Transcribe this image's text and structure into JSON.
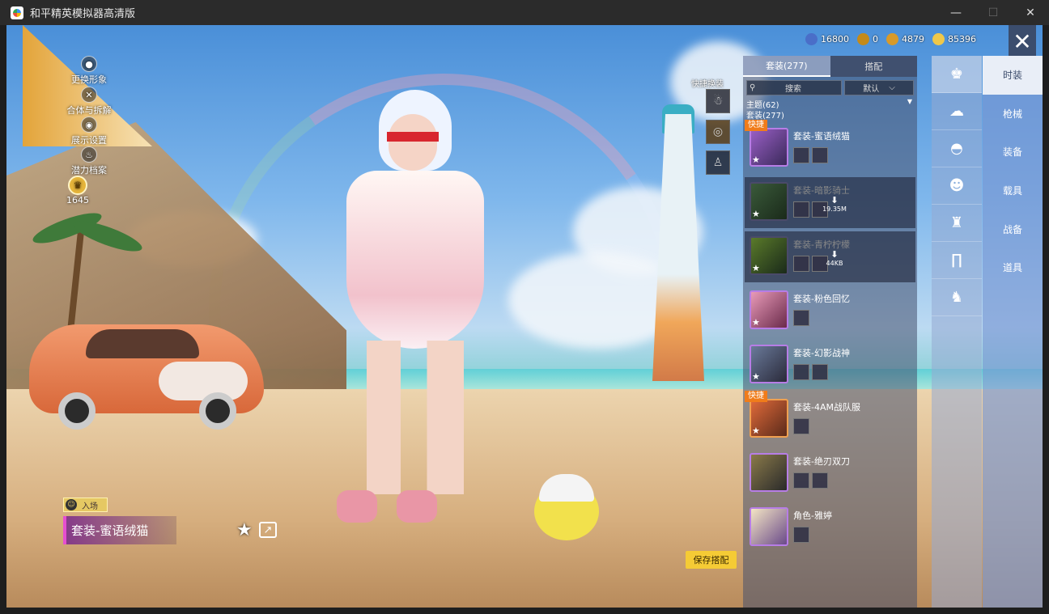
{
  "window": {
    "title": "和平精英模拟器高清版",
    "minimize": "—",
    "maximize": "☐",
    "close": "✕"
  },
  "left_menu": [
    {
      "label": "更换形象",
      "icon": "person-icon"
    },
    {
      "label": "合体与拆解",
      "icon": "split-icon"
    },
    {
      "label": "展示设置",
      "icon": "eye-icon"
    },
    {
      "label": "潜力档案",
      "icon": "flame-icon"
    }
  ],
  "level": {
    "value": "1645"
  },
  "enter_badge": {
    "label": "入场"
  },
  "current_outfit": {
    "name": "套装-蜜语绒猫"
  },
  "quick_change": {
    "label": "快捷换装"
  },
  "save_button": {
    "label": "保存搭配"
  },
  "currency": [
    {
      "value": "16800",
      "color": "#4a6ec8"
    },
    {
      "value": "0",
      "color": "#c48a1a"
    },
    {
      "value": "4879",
      "color": "#d89a2a"
    },
    {
      "value": "85396",
      "color": "#f0c84a"
    }
  ],
  "panel": {
    "tabs": [
      {
        "label": "套装(277)",
        "active": true
      },
      {
        "label": "搭配",
        "active": false
      }
    ],
    "search_placeholder": "搜索",
    "sort_label": "默认",
    "theme_line": "主题(62)",
    "suit_line": "套装(277)",
    "fast_tag": "快捷",
    "items": [
      {
        "name": "套装-蜜语绒猫",
        "fast": true,
        "downloaded": true,
        "chips": 2
      },
      {
        "name": "套装-暗影骑士",
        "fast": false,
        "downloaded": false,
        "size": "19.35M",
        "chips": 2
      },
      {
        "name": "套装-青柠柠檬",
        "fast": false,
        "downloaded": false,
        "size": "44KB",
        "chips": 2
      },
      {
        "name": "套装-粉色回忆",
        "fast": false,
        "downloaded": true,
        "chips": 1
      },
      {
        "name": "套装-幻影战神",
        "fast": false,
        "downloaded": true,
        "chips": 2
      },
      {
        "name": "套装-4AM战队服",
        "fast": true,
        "downloaded": true,
        "chips": 1
      },
      {
        "name": "套装-绝刃双刀",
        "fast": false,
        "downloaded": true,
        "chips": 2
      },
      {
        "name": "角色-雅婷",
        "fast": false,
        "downloaded": true,
        "chips": 1
      }
    ]
  },
  "categories": [
    {
      "label": "时装",
      "active": true
    },
    {
      "label": "枪械",
      "active": false
    },
    {
      "label": "装备",
      "active": false
    },
    {
      "label": "载具",
      "active": false
    },
    {
      "label": "战备",
      "active": false
    },
    {
      "label": "道具",
      "active": false
    }
  ]
}
